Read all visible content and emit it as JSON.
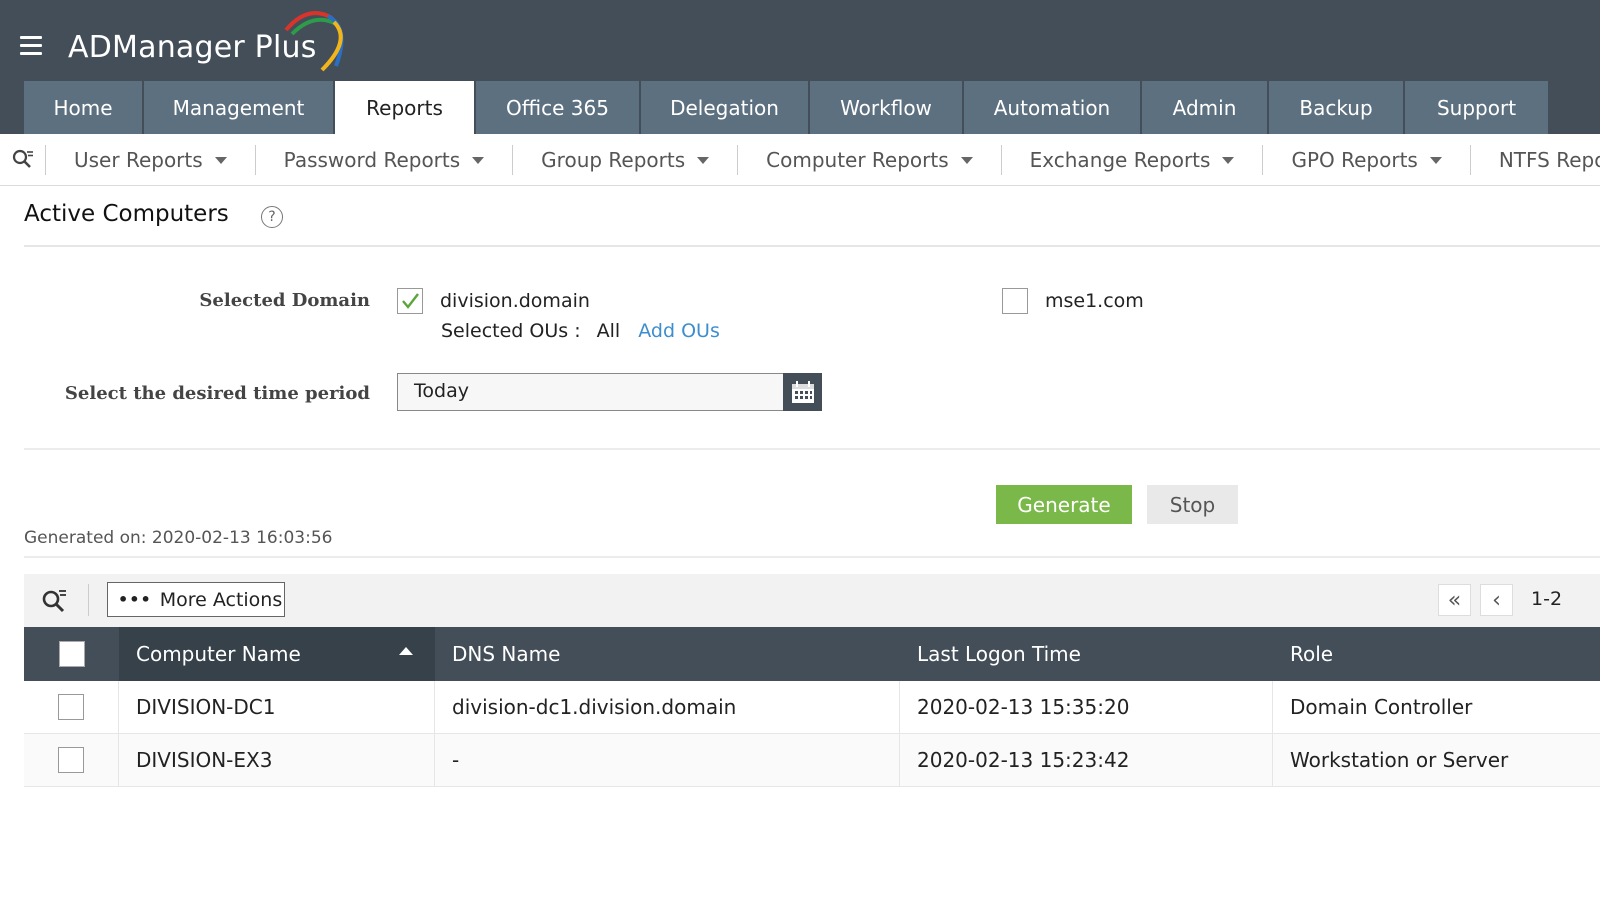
{
  "app": {
    "title": "ADManager Plus"
  },
  "nav": {
    "tabs": [
      {
        "label": "Home"
      },
      {
        "label": "Management"
      },
      {
        "label": "Reports"
      },
      {
        "label": "Office 365"
      },
      {
        "label": "Delegation"
      },
      {
        "label": "Workflow"
      },
      {
        "label": "Automation"
      },
      {
        "label": "Admin"
      },
      {
        "label": "Backup"
      },
      {
        "label": "Support"
      }
    ],
    "active_tab": "Reports"
  },
  "subnav": {
    "items": [
      {
        "label": "User Reports"
      },
      {
        "label": "Password Reports"
      },
      {
        "label": "Group Reports"
      },
      {
        "label": "Computer Reports"
      },
      {
        "label": "Exchange Reports"
      },
      {
        "label": "GPO Reports"
      },
      {
        "label": "NTFS Repo"
      }
    ]
  },
  "page": {
    "title": "Active Computers",
    "help": "?"
  },
  "form": {
    "domain_label": "Selected Domain",
    "domains": [
      {
        "name": "division.domain",
        "checked": true
      },
      {
        "name": "mse1.com",
        "checked": false
      }
    ],
    "ous_label": "Selected OUs :",
    "ous_value": "All",
    "add_ous": "Add OUs",
    "period_label": "Select the desired time period",
    "period_value": "Today"
  },
  "actions": {
    "generate": "Generate",
    "stop": "Stop",
    "generated_on": "Generated on: 2020-02-13 16:03:56"
  },
  "toolbar": {
    "more_actions": "More Actions",
    "page_range": "1-2"
  },
  "table": {
    "columns": [
      "Computer Name",
      "DNS Name",
      "Last Logon Time",
      "Role"
    ],
    "rows": [
      {
        "name": "DIVISION-DC1",
        "dns": "division-dc1.division.domain",
        "logon": "2020-02-13 15:35:20",
        "role": "Domain Controller"
      },
      {
        "name": "DIVISION-EX3",
        "dns": "-",
        "logon": "2020-02-13 15:23:42",
        "role": "Workstation or Server"
      }
    ]
  },
  "colors": {
    "header_bg": "#434e58",
    "tab_bg": "#5d7080",
    "generate_green": "#7ab949",
    "link_blue": "#3d8ecf"
  }
}
